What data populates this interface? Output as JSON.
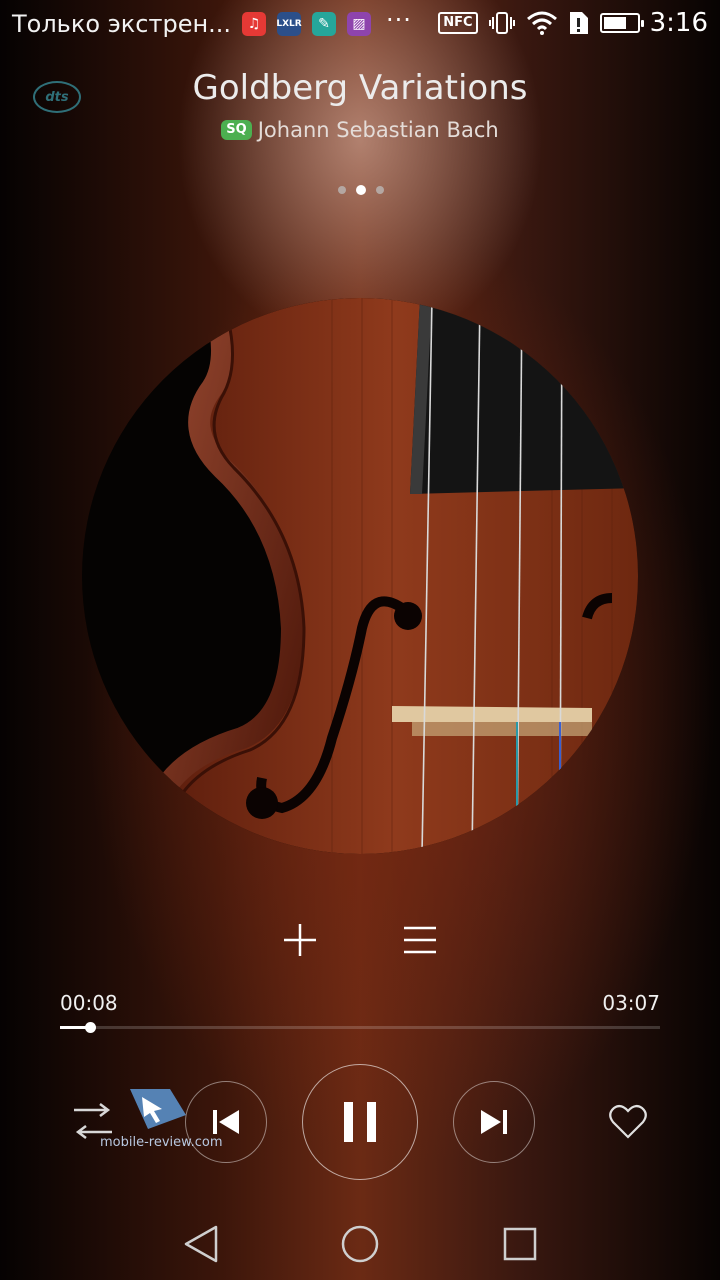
{
  "status_bar": {
    "notification_text": "Только экстрен...",
    "notification_icons": [
      "music-app-icon",
      "grid-app-icon",
      "notes-app-icon",
      "gallery-app-icon"
    ],
    "more_icon": "···",
    "nfc_label": "NFC",
    "battery_level": 0.7,
    "time": "3:16"
  },
  "player": {
    "dts_label": "dts",
    "title": "Goldberg Variations",
    "quality_badge": "SQ",
    "artist": "Johann Sebastian Bach",
    "page_count": 3,
    "active_page": 1,
    "album_art": "violin-album-art",
    "elapsed": "00:08",
    "total": "03:07",
    "progress": 0.05
  },
  "controls": {
    "add_icon": "plus-icon",
    "queue_icon": "queue-list-icon",
    "shuffle_icon": "shuffle-icon",
    "prev_icon": "previous-track-icon",
    "pause_icon": "pause-icon",
    "next_icon": "next-track-icon",
    "favorite_icon": "heart-icon"
  },
  "watermark": {
    "text": "mobile-review.com"
  },
  "navbar": {
    "back_icon": "back-icon",
    "home_icon": "home-icon",
    "recents_icon": "recents-icon"
  },
  "colors": {
    "sq_badge": "#4caf50",
    "dts_logo": "#2f6f78",
    "accent": "#ffffff"
  }
}
